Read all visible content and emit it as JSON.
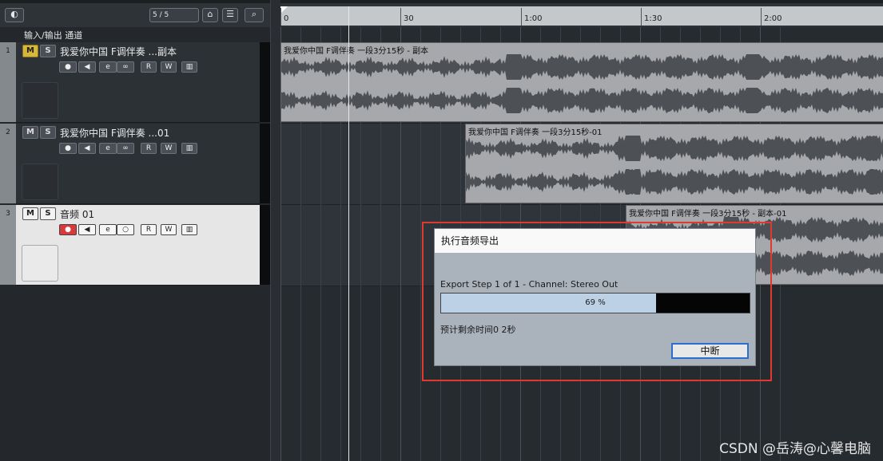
{
  "toolbar": {
    "counter": "5 / 5"
  },
  "track_header": {
    "label": "输入/输出 通道"
  },
  "tracks": [
    {
      "number": "1",
      "name": "我爱你中国 F调伴奏 ...副本",
      "mute": "M",
      "solo": "S",
      "read": "R",
      "write": "W",
      "muted": true
    },
    {
      "number": "2",
      "name": "我爱你中国 F调伴奏 ...01",
      "mute": "M",
      "solo": "S",
      "read": "R",
      "write": "W",
      "muted": false
    },
    {
      "number": "3",
      "name": "音频 01",
      "mute": "M",
      "solo": "S",
      "read": "R",
      "write": "W",
      "muted": false
    }
  ],
  "ruler": {
    "labels": [
      "0",
      "30",
      "1:00",
      "1:30",
      "2:00"
    ]
  },
  "clips": [
    {
      "label": "我爱你中国 F调伴奏 一段3分15秒 - 副本"
    },
    {
      "label": "我爱你中国 F调伴奏 一段3分15秒-01"
    },
    {
      "label": "我爱你中国 F调伴奏 一段3分15秒 - 副本-01"
    }
  ],
  "dialog": {
    "title": "执行音频导出",
    "step_text": "Export Step 1 of 1  - Channel: Stereo Out",
    "progress_text": "69 %",
    "progress_value": 0.69,
    "remaining_text": "预计剩余时间0 2秒",
    "abort_label": "中断"
  },
  "watermark": "CSDN @岳涛@心馨电脑",
  "colors": {
    "mute_active": "#d6b73a",
    "record_active": "#d83a3a",
    "progress_fill": "#bcd0e6",
    "highlight_box": "#e03a30",
    "button_focus": "#2a6fd0"
  }
}
